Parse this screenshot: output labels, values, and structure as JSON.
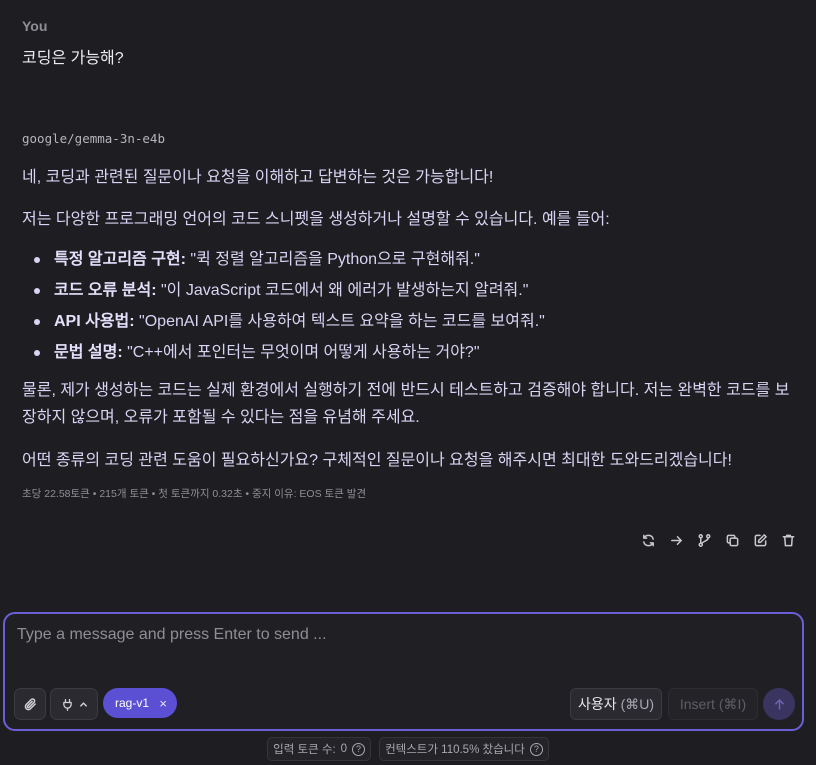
{
  "user": {
    "sender_label": "You",
    "message": "코딩은 가능해?"
  },
  "assistant": {
    "model_name": "google/gemma-3n-e4b",
    "paragraphs": {
      "intro": "네, 코딩과 관련된 질문이나 요청을 이해하고 답변하는 것은 가능합니다!",
      "lead": "저는 다양한 프로그래밍 언어의 코드 스니펫을 생성하거나 설명할 수 있습니다. 예를 들어:",
      "caveat": "물론, 제가 생성하는 코드는 실제 환경에서 실행하기 전에 반드시 테스트하고 검증해야 합니다. 저는 완벽한 코드를 보장하지 않으며, 오류가 포함될 수 있다는 점을 유념해 주세요.",
      "closing": "어떤 종류의 코딩 관련 도움이 필요하신가요? 구체적인 질문이나 요청을 해주시면 최대한 도와드리겠습니다!"
    },
    "bullets": [
      {
        "label": "특정 알고리즘 구현:",
        "text": " \"퀵 정렬 알고리즘을 Python으로 구현해줘.\""
      },
      {
        "label": "코드 오류 분석:",
        "text": " \"이 JavaScript 코드에서 왜 에러가 발생하는지 알려줘.\""
      },
      {
        "label": "API 사용법:",
        "text": " \"OpenAI API를 사용하여 텍스트 요약을 하는 코드를 보여줘.\""
      },
      {
        "label": "문법 설명:",
        "text": " \"C++에서 포인터는 무엇이며 어떻게 사용하는 거야?\""
      }
    ],
    "stats": "초당 22.58토큰 • 215개 토큰 • 첫 토큰까지 0.32초 • 중지 이유: EOS 토큰 발견"
  },
  "actions": {
    "icons": [
      "regenerate-icon",
      "continue-icon",
      "branch-icon",
      "copy-icon",
      "edit-icon",
      "delete-icon"
    ]
  },
  "composer": {
    "placeholder": "Type a message and press Enter to send ...",
    "chip_label": "rag-v1",
    "chip_close": "×",
    "role_button": "사용자",
    "role_shortcut": "(⌘U)",
    "insert_button": "Insert",
    "insert_shortcut": "(⌘I)"
  },
  "footer": {
    "input_tokens_label": "입력 토큰 수:",
    "input_tokens_value": "0",
    "context_status": "컨텍스트가 110.5% 찼습니다",
    "help_glyph": "?"
  },
  "colors": {
    "accent": "#6b5fd8",
    "chip": "#5b4fd3",
    "background": "#1e1e22",
    "message_text": "#d8d4f4"
  }
}
